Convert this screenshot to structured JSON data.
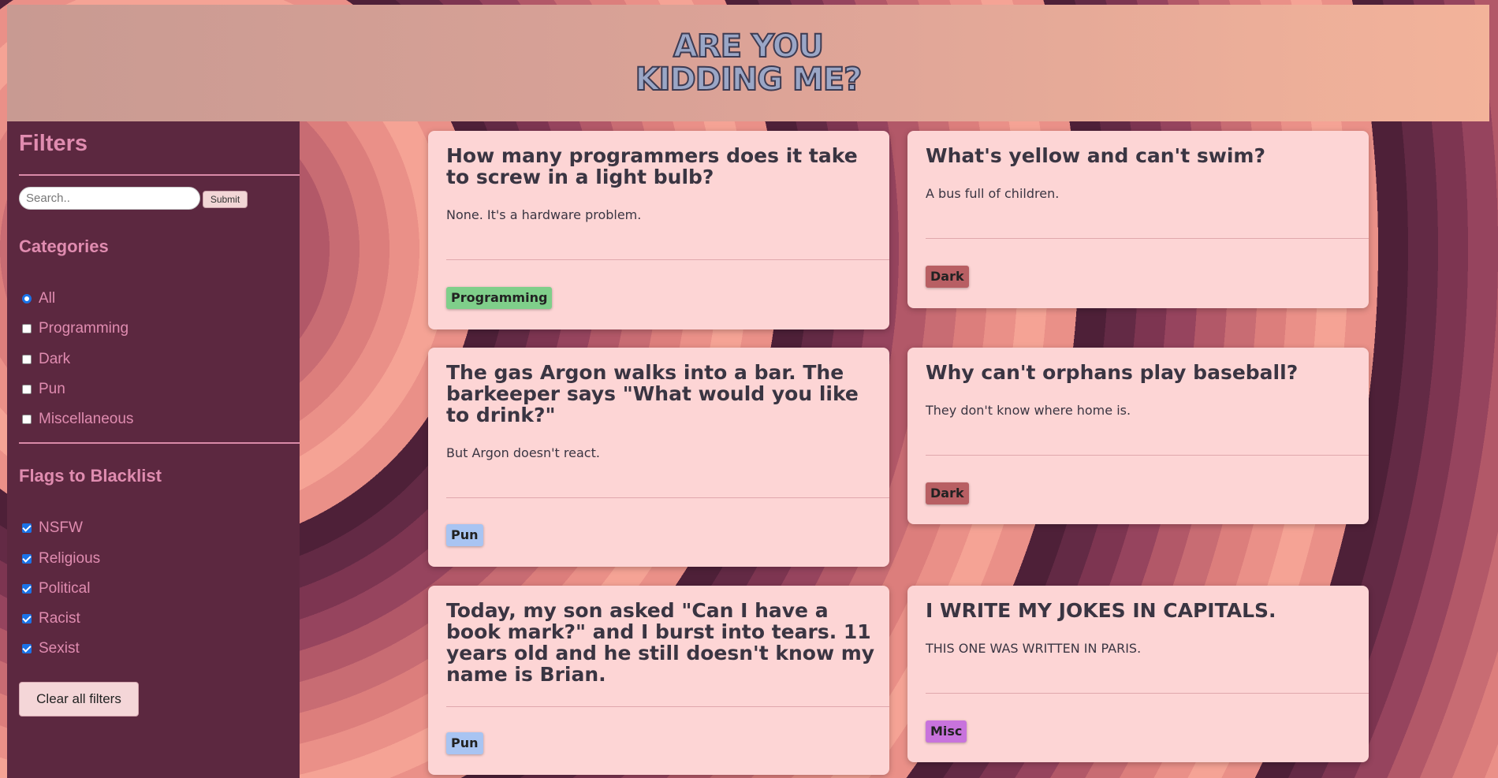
{
  "logo": {
    "line1": "ARE YOU",
    "line2": "KIDDING ME?"
  },
  "sidebar": {
    "title": "Filters",
    "search": {
      "placeholder": "Search..",
      "value": "",
      "submit_label": "Submit"
    },
    "categories": {
      "title": "Categories",
      "options": [
        {
          "label": "All",
          "checked": true,
          "kind": "radio"
        },
        {
          "label": "Programming",
          "checked": false,
          "kind": "checkbox"
        },
        {
          "label": "Dark",
          "checked": false,
          "kind": "checkbox"
        },
        {
          "label": "Pun",
          "checked": false,
          "kind": "checkbox"
        },
        {
          "label": "Miscellaneous",
          "checked": false,
          "kind": "checkbox"
        }
      ]
    },
    "flags": {
      "title": "Flags to Blacklist",
      "options": [
        {
          "label": "NSFW",
          "checked": true
        },
        {
          "label": "Religious",
          "checked": true
        },
        {
          "label": "Political",
          "checked": true
        },
        {
          "label": "Racist",
          "checked": true
        },
        {
          "label": "Sexist",
          "checked": true
        }
      ]
    },
    "clear_label": "Clear all filters"
  },
  "jokes": [
    {
      "setup": "How many programmers does it take to screw in a light bulb?",
      "delivery": "None. It's a hardware problem.",
      "tag": "Programming",
      "tag_color": "#7fcf8a"
    },
    {
      "setup": "What's yellow and can't swim?",
      "delivery": "A bus full of children.",
      "tag": "Dark",
      "tag_color": "#b85f63"
    },
    {
      "setup": "The gas Argon walks into a bar. The barkeeper says \"What would you like to drink?\"",
      "delivery": "But Argon doesn't react.",
      "tag": "Pun",
      "tag_color": "#a8c4f2"
    },
    {
      "setup": "Why can't orphans play baseball?",
      "delivery": "They don't know where home is.",
      "tag": "Dark",
      "tag_color": "#b85f63"
    },
    {
      "setup": "Today, my son asked \"Can I have a book mark?\" and I burst into tears. 11 years old and he still doesn't know my name is Brian.",
      "delivery": "",
      "tag": "Pun",
      "tag_color": "#a8c4f2"
    },
    {
      "setup": "I WRITE MY JOKES IN CAPITALS.",
      "delivery": "THIS ONE WAS WRITTEN IN PARIS.",
      "tag": "Misc",
      "tag_color": "#c873dc"
    }
  ]
}
